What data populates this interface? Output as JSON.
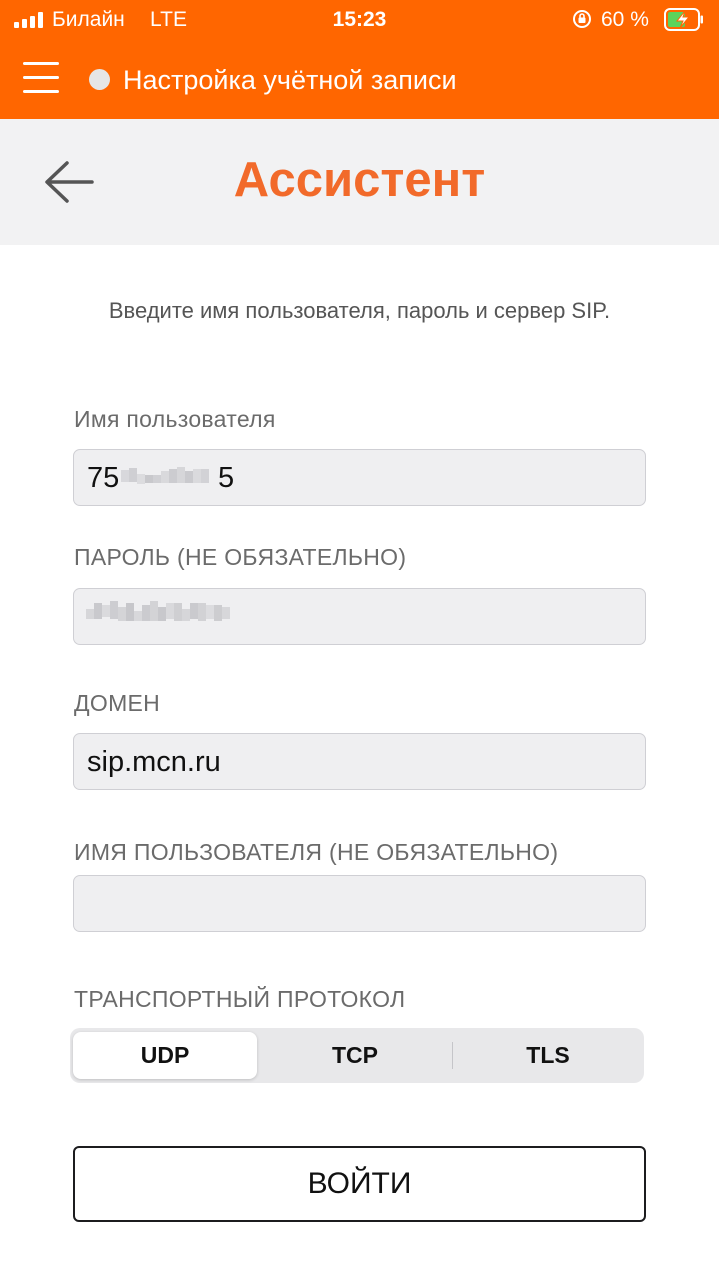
{
  "status_bar": {
    "carrier": "Билайн",
    "network": "LTE",
    "time": "15:23",
    "battery_percent": "60 %",
    "battery_level": 0.6,
    "icons": [
      "signal-icon",
      "rotation-lock-icon",
      "battery-charging-icon"
    ]
  },
  "app_bar": {
    "title": "Настройка учётной записи",
    "color": "#ff6600",
    "icons": [
      "menu-icon",
      "status-dot-icon"
    ]
  },
  "header": {
    "title": "Ассистент",
    "title_color": "#f26a2a",
    "back_icon": "arrow-left-icon"
  },
  "instructions": "Введите имя пользователя, пароль и сервер SIP.",
  "form": {
    "username": {
      "label": "Имя пользователя",
      "prefix": "75",
      "suffix": "5"
    },
    "password": {
      "label": "ПАРОЛЬ (НЕ ОБЯЗАТЕЛЬНО)"
    },
    "domain": {
      "label": "ДОМЕН",
      "value": "sip.mcn.ru"
    },
    "auth_username": {
      "label": "ИМЯ ПОЛЬЗОВАТЕЛЯ (НЕ ОБЯЗАТЕЛЬНО)",
      "value": ""
    },
    "transport": {
      "label": "ТРАНСПОРТНЫЙ ПРОТОКОЛ",
      "options": [
        "UDP",
        "TCP",
        "TLS"
      ],
      "selected": "UDP"
    }
  },
  "login_button": "ВОЙТИ"
}
